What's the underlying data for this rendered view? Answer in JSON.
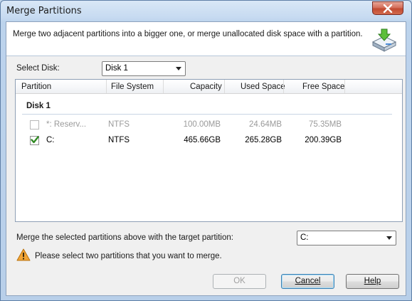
{
  "window": {
    "title": "Merge Partitions"
  },
  "header": {
    "description": "Merge two adjacent partitions into a bigger one, or merge unallocated disk space with a partition."
  },
  "disk_select": {
    "label": "Select Disk:",
    "value": "Disk 1"
  },
  "table": {
    "columns": {
      "partition": "Partition",
      "file_system": "File System",
      "capacity": "Capacity",
      "used_space": "Used Space",
      "free_space": "Free Space"
    },
    "group_title": "Disk 1",
    "rows": [
      {
        "name": "*: Reserv...",
        "file_system": "NTFS",
        "capacity": "100.00MB",
        "used": "24.64MB",
        "free": "75.35MB",
        "checked": false,
        "enabled": false
      },
      {
        "name": "C:",
        "file_system": "NTFS",
        "capacity": "465.66GB",
        "used": "265.28GB",
        "free": "200.39GB",
        "checked": true,
        "enabled": true
      }
    ]
  },
  "target": {
    "label": "Merge the selected partitions above with the target partition:",
    "value": "C:"
  },
  "warning": {
    "text": "Please select two partitions that you want to merge."
  },
  "buttons": {
    "ok_label": "OK",
    "cancel_label": "Cancel",
    "help_label": "Help"
  }
}
